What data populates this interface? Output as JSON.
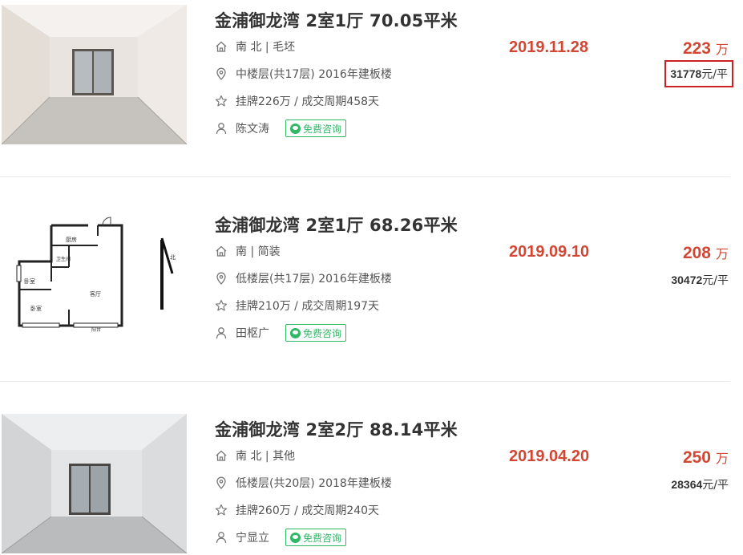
{
  "listings": [
    {
      "title": "金浦御龙湾 2室1厅 70.05平米",
      "house_info": "南 北 | 毛坯",
      "position_info": "中楼层(共17层) 2016年建板楼",
      "deal_info": "挂牌226万 / 成交周期458天",
      "agent": "陈文涛",
      "consult_label": "免费咨询",
      "deal_date": "2019.11.28",
      "total_price": "223",
      "total_unit": "万",
      "unit_price_num": "31778",
      "unit_price_unit": "元/平",
      "thumb_type": "photo"
    },
    {
      "title": "金浦御龙湾 2室1厅 68.26平米",
      "house_info": "南 | 简装",
      "position_info": "低楼层(共17层) 2016年建板楼",
      "deal_info": "挂牌210万 / 成交周期197天",
      "agent": "田枢广",
      "consult_label": "免费咨询",
      "deal_date": "2019.09.10",
      "total_price": "208",
      "total_unit": "万",
      "unit_price_num": "30472",
      "unit_price_unit": "元/平",
      "thumb_type": "floorplan",
      "floorplan_labels": {
        "kitchen": "厨房",
        "bath": "卫生间",
        "bed1": "卧室",
        "bed2": "卧室",
        "living": "客厅",
        "balcony": "阳台",
        "north": "北"
      }
    },
    {
      "title": "金浦御龙湾 2室2厅 88.14平米",
      "house_info": "南 北 | 其他",
      "position_info": "低楼层(共20层) 2018年建板楼",
      "deal_info": "挂牌260万 / 成交周期240天",
      "agent": "宁显立",
      "consult_label": "免费咨询",
      "deal_date": "2019.04.20",
      "total_price": "250",
      "total_unit": "万",
      "unit_price_num": "28364",
      "unit_price_unit": "元/平",
      "thumb_type": "photo"
    }
  ],
  "colors": {
    "price_red": "#d14733",
    "highlight_box": "#cc1f26",
    "consult_green": "#30b866"
  },
  "icons": [
    "house-icon",
    "location-icon",
    "star-icon",
    "user-icon",
    "wechat-icon"
  ]
}
